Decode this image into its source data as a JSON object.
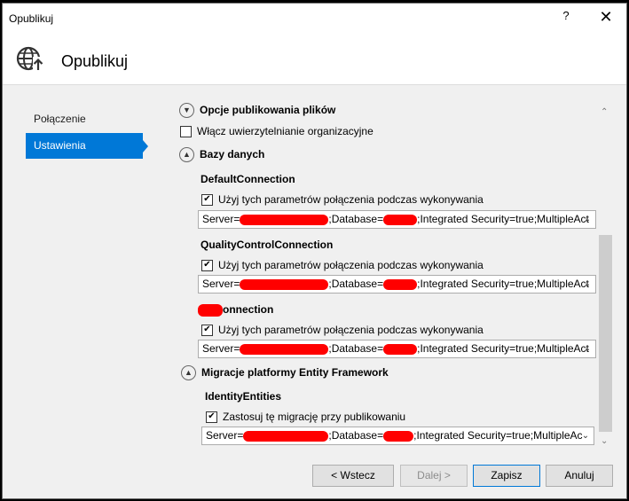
{
  "window": {
    "title": "Opublikuj",
    "help_glyph": "?",
    "close_glyph": "✕"
  },
  "header": {
    "title": "Opublikuj",
    "icon": "globe-publish-icon"
  },
  "nav": {
    "items": [
      {
        "label": "Połączenie",
        "active": false
      },
      {
        "label": "Ustawienia",
        "active": true
      }
    ]
  },
  "settings": {
    "file_publish_options_label": "Opcje publikowania plików",
    "org_auth": {
      "label": "Włącz uwierzytelnianie organizacyjne",
      "checked": false
    },
    "databases_label": "Bazy danych",
    "connections": [
      {
        "name": "DefaultConnection",
        "use_at_runtime": {
          "label": "Użyj tych parametrów połączenia podczas wykonywania",
          "checked": true
        },
        "conn_string": {
          "server_prefix": "Server=",
          "database_prefix": "Database=",
          "tail": "Integrated Security=true;MultipleAct"
        }
      },
      {
        "name": "QualityControlConnection",
        "use_at_runtime": {
          "label": "Użyj tych parametrów połączenia podczas wykonywania",
          "checked": true
        },
        "conn_string": {
          "server_prefix": "Server=",
          "database_prefix": "Database=",
          "tail": "Integrated Security=true;MultipleAct"
        }
      },
      {
        "name": "onnection",
        "use_at_runtime": {
          "label": "Użyj tych parametrów połączenia podczas wykonywania",
          "checked": true
        },
        "conn_string": {
          "server_prefix": "Server=",
          "database_prefix": "Database=",
          "tail": "Integrated Security=true;MultipleAct"
        }
      }
    ],
    "ef_migrations_label": "Migracje platformy Entity Framework",
    "migration": {
      "name": "IdentityEntities",
      "apply_on_publish": {
        "label": "Zastosuj tę migrację przy publikowaniu",
        "checked": true
      },
      "conn_string": {
        "server_prefix": "Server=",
        "database_prefix": "Database=",
        "tail": "Integrated Security=true;MultipleAc"
      }
    },
    "colors": {
      "accent": "#0078d7",
      "redaction": "#ff0000"
    }
  },
  "buttons": {
    "back": "< Wstecz",
    "next": "Dalej >",
    "save": "Zapisz",
    "cancel": "Anuluj"
  }
}
